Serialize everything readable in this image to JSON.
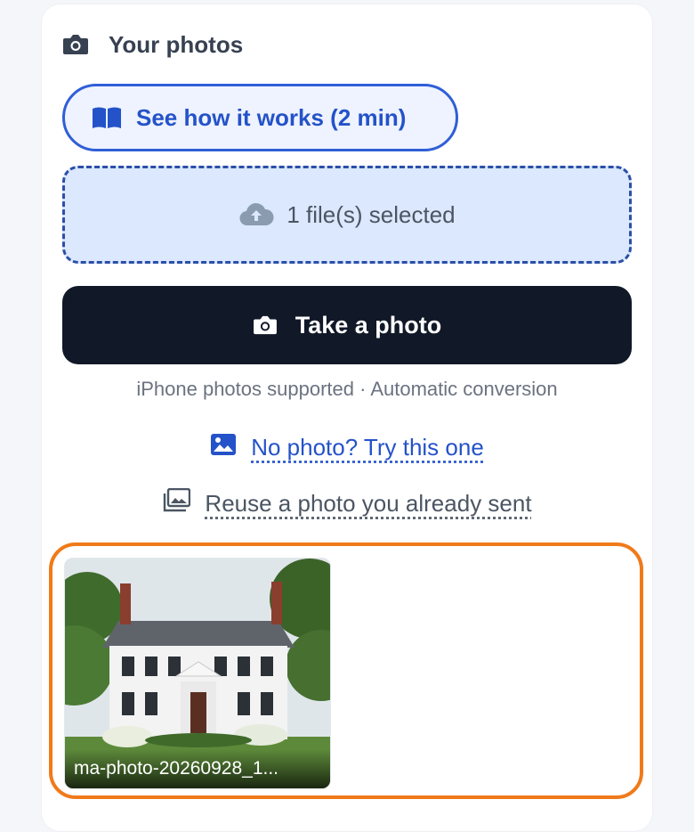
{
  "section": {
    "title": "Your photos",
    "title_icon": "camera-icon"
  },
  "how_it_works": {
    "label": "See how it works (2 min)",
    "icon": "book-open-icon"
  },
  "upload": {
    "status": "1 file(s) selected",
    "icon": "cloud-upload-icon"
  },
  "take_photo": {
    "label": "Take a photo",
    "icon": "camera-icon"
  },
  "support_note": "iPhone photos supported · Automatic conversion",
  "sample_link": {
    "label": "No photo? Try this one",
    "icon": "image-icon"
  },
  "reuse_link": {
    "label": "Reuse a photo you already sent",
    "icon": "images-stack-icon"
  },
  "selected_photos": [
    {
      "filename": "ma-photo-20260928_1..."
    }
  ],
  "colors": {
    "accent_blue": "#2452c9",
    "dropzone_bg": "#dbe8fd",
    "primary_dark": "#111827",
    "highlight_orange": "#f07a1a"
  }
}
